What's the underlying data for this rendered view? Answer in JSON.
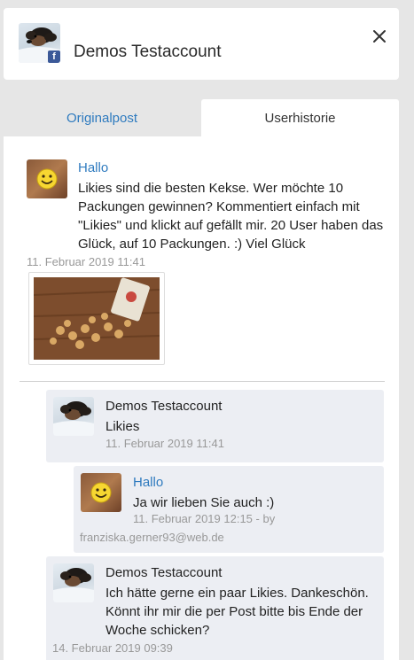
{
  "header": {
    "title": "Demos Testaccount",
    "badge_letter": "f",
    "badge_color": "#3b5998"
  },
  "tabs": [
    {
      "label": "Originalpost",
      "active": false
    },
    {
      "label": "Userhistorie",
      "active": true
    }
  ],
  "original_post": {
    "author": "Hallo",
    "text": "Likies sind die besten Kekse. Wer möchte 10 Packungen gewinnen? Kommentiert einfach mit \"Likies\" und klickt auf gefällt mir. 20 User haben das Glück, auf 10 Packungen. :) Viel Glück",
    "lines": [
      "Likies sind die besten Kekse. Wer möchte 10",
      "Packungen gewinnen? Kommentiert einfach mit",
      "\"Likies\" und klickt auf gefällt mir. 20 User haben das",
      "Glück, auf 10 Packungen. :) Viel Glück"
    ],
    "timestamp": "11. Februar 2019 11:41"
  },
  "history": [
    {
      "author": "Demos Testaccount",
      "lines": [
        "Likies"
      ],
      "timestamp": "11. Februar 2019 11:41"
    },
    {
      "author": "Hallo",
      "lines": [
        "Ja wir lieben Sie auch :)"
      ],
      "timestamp": "11. Februar 2019 12:15 - by",
      "by": "franziska.gerner93@web.de"
    },
    {
      "author": "Demos Testaccount",
      "lines": [
        "Ich hätte gerne ein paar Likies. Dankeschön.",
        "Könnt ihr mir die per Post bitte bis Ende der",
        "Woche schicken?"
      ],
      "timestamp": "14. Februar 2019 09:39"
    }
  ],
  "icons": {
    "close": "close-icon",
    "smiley": "smiley-icon",
    "facebook": "facebook-icon"
  },
  "colors": {
    "link": "#2f7bbf",
    "muted": "#999999",
    "reply_bg": "#eceef3"
  }
}
